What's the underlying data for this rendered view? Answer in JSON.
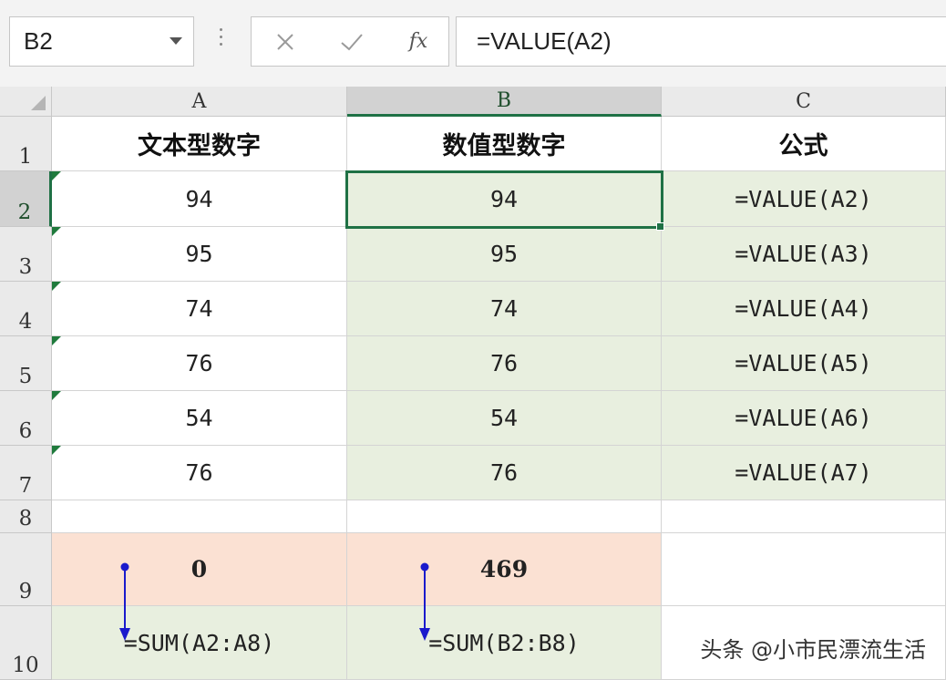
{
  "formula_bar": {
    "name_box": "B2",
    "formula": "=VALUE(A2)",
    "icons": [
      "dropdown-arrow-icon",
      "more-options-icon",
      "cancel-icon",
      "check-icon",
      "fx-icon"
    ],
    "fx_label": "fx"
  },
  "sheet": {
    "columns": [
      "A",
      "B",
      "C"
    ],
    "rows": [
      "1",
      "2",
      "3",
      "4",
      "5",
      "6",
      "7",
      "8",
      "9",
      "10"
    ],
    "selected_cell": "B2",
    "headers": {
      "a": "文本型数字",
      "b": "数值型数字",
      "c": "公式"
    },
    "data_rows": [
      {
        "a": "94",
        "b": "94",
        "c": "=VALUE(A2)"
      },
      {
        "a": "95",
        "b": "95",
        "c": "=VALUE(A3)"
      },
      {
        "a": "74",
        "b": "74",
        "c": "=VALUE(A4)"
      },
      {
        "a": "76",
        "b": "76",
        "c": "=VALUE(A5)"
      },
      {
        "a": "54",
        "b": "54",
        "c": "=VALUE(A6)"
      },
      {
        "a": "76",
        "b": "76",
        "c": "=VALUE(A7)"
      }
    ],
    "row9": {
      "a": "0",
      "b": "469"
    },
    "row10": {
      "a": "=SUM(A2:A8)",
      "b": "=SUM(B2:B8)"
    },
    "colors": {
      "green_fill": "#e8efdf",
      "peach_fill": "#fbe1d3",
      "selection": "#1f7145",
      "warning_triangle": "#1f7a3c",
      "annotation_arrow": "#1a1acc"
    }
  },
  "watermark": "头条 @小市民漂流生活"
}
